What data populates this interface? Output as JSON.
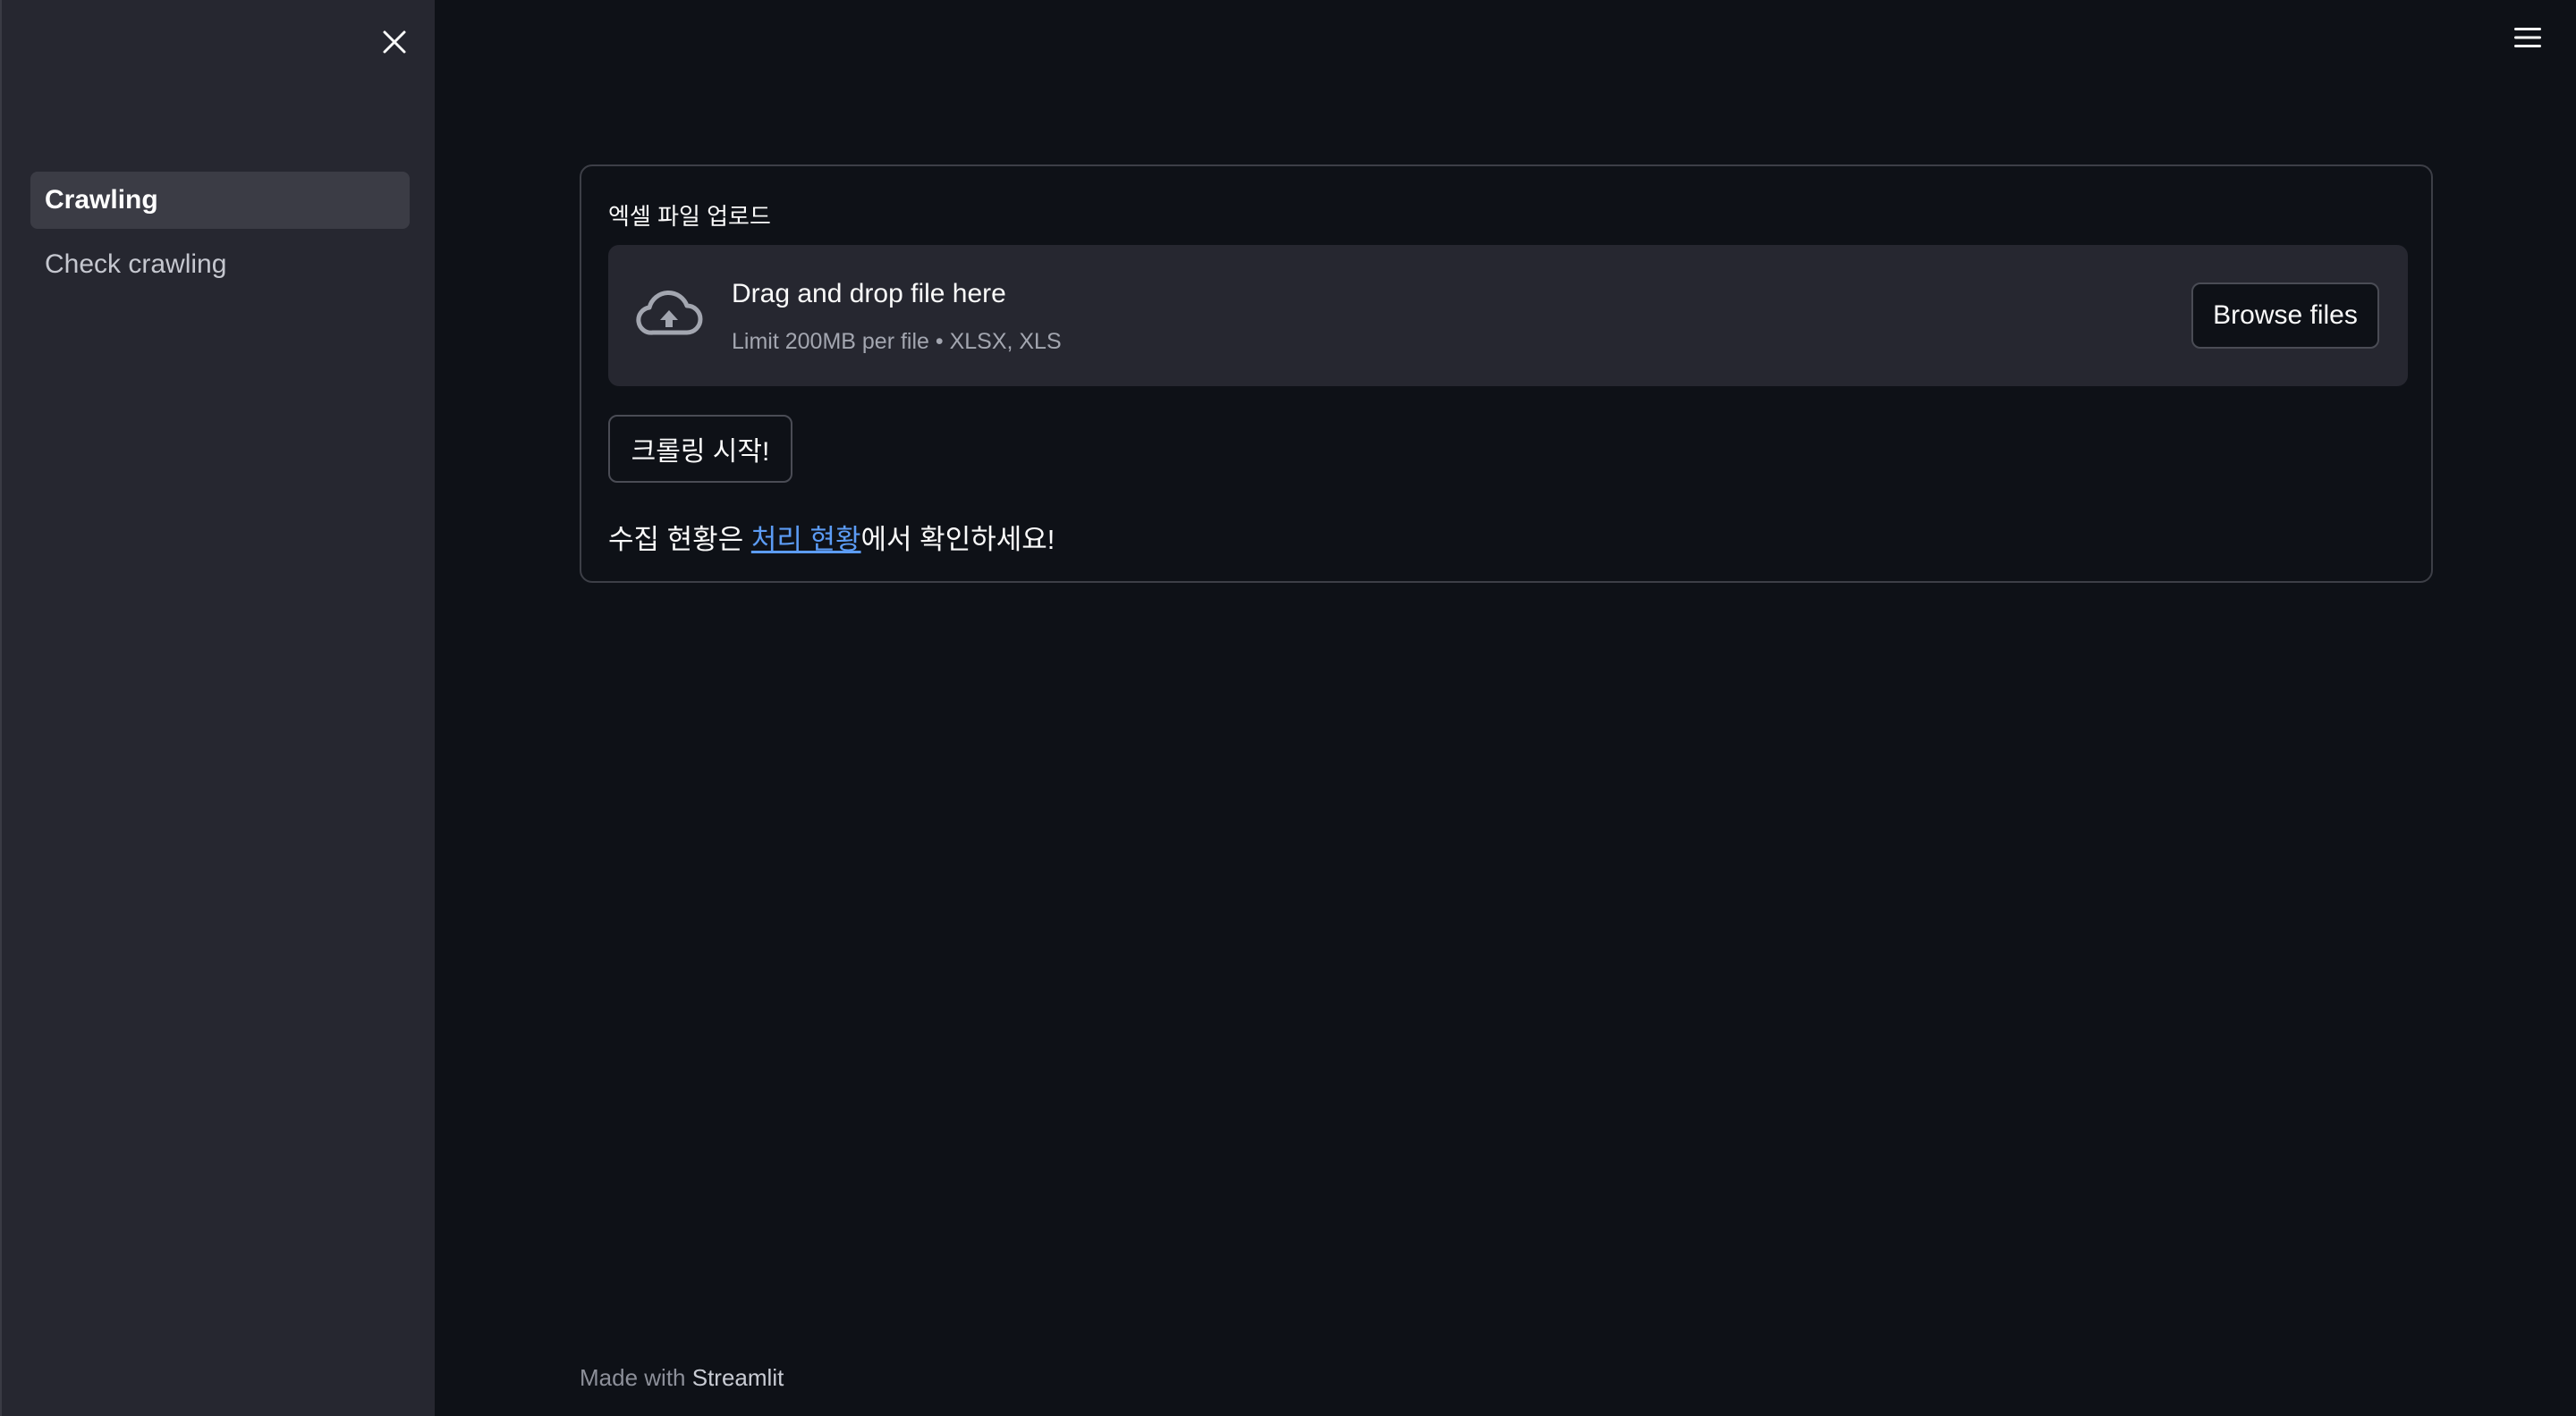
{
  "sidebar": {
    "close_icon": "close-icon",
    "items": [
      {
        "label": "Crawling",
        "active": true
      },
      {
        "label": "Check crawling",
        "active": false
      }
    ]
  },
  "header": {
    "menu_icon": "hamburger-menu-icon"
  },
  "uploader": {
    "label": "엑셀 파일 업로드",
    "icon": "cloud-upload-icon",
    "title": "Drag and drop file here",
    "limit": "Limit 200MB per file • XLSX, XLS",
    "browse_label": "Browse files"
  },
  "actions": {
    "start_label": "크롤링 시작!"
  },
  "status": {
    "prefix": "수집 현황은 ",
    "link_text": "처리 현황",
    "suffix": "에서 확인하세요!"
  },
  "footer": {
    "prefix": "Made with ",
    "brand": "Streamlit"
  },
  "colors": {
    "background": "#0e1117",
    "sidebar": "#262730",
    "link": "#5c9cf5"
  }
}
